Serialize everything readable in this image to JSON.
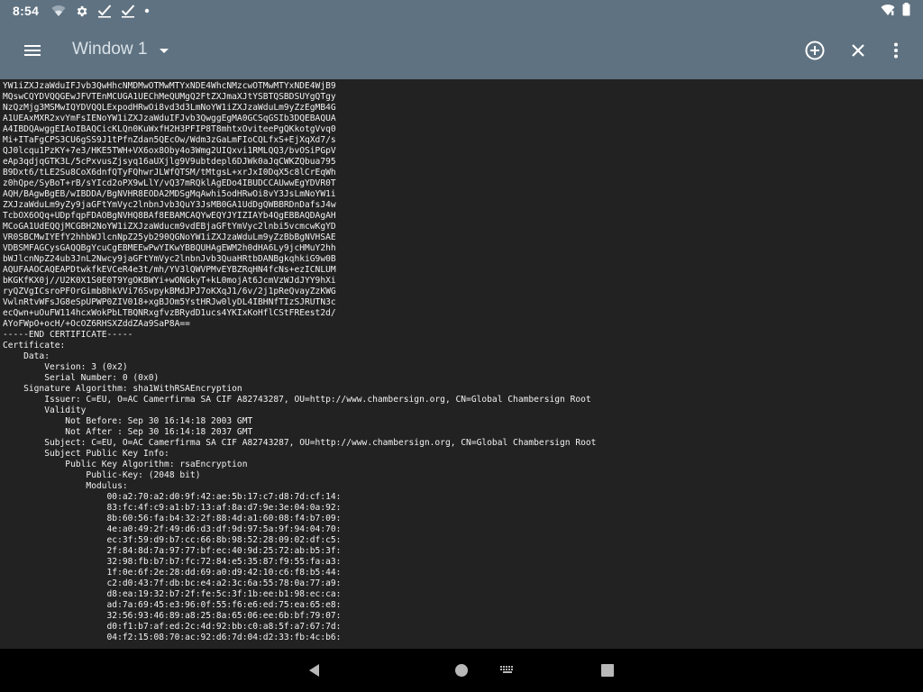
{
  "status_bar": {
    "time": "8:54",
    "icons": [
      "wifi-off-icon",
      "settings-icon",
      "check-icon",
      "check-icon",
      "dot-icon",
      "wifi-icon",
      "battery-icon"
    ]
  },
  "app_bar": {
    "title": "Window 1",
    "icons": [
      "menu-icon",
      "dropdown-icon",
      "add-circle-icon",
      "close-icon",
      "more-vert-icon"
    ]
  },
  "terminal": {
    "lines": [
      "YW1iZXJzaWduIFJvb3QwHhcNMDMwOTMwMTYxNDE4WhcNMzcwOTMwMTYxNDE4WjB9",
      "MQswCQYDVQQGEwJFVTEnMCUGA1UEChMeQUMgQ2FtZXJmaXJtYSBTQSBDSUYgQTgy",
      "NzQzMjg3MSMwIQYDVQQLExpodHRwOi8vd3d3LmNoYW1iZXJzaWduLm9yZzEgMB4G",
      "A1UEAxMXR2xvYmFsIENoYW1iZXJzaWduIFJvb3QwggEgMA0GCSqGSIb3DQEBAQUA",
      "A4IBDQAwggEIAoIBAQCicKLQn0KuWxfH2H3PFIP8T8mhtxOviteePgQKkotgVvq0",
      "Mi+ITaFgCPS3CU6gSS9J1tPfnZdan5QEcOw/Wdm3zGaLmFIoCQLfxS+EjXqXd7/s",
      "QJ0lcqu1PzKY+7e3/HKE5TWH+VX6ox8Oby4o3Wmg2UIQxvi1RMLQQ3/bvOSiPGpV",
      "eAp3qdjqGTK3L/5cPxvusZjsyq16aUXjlg9V9ubtdepl6DJWk0aJqCWKZQbua795",
      "B9Dxt6/tLE2Su8CoX6dnfQTyFQhwrJLWfQTSM/tMtgsL+xrJxI0DqX5c8lCrEqWh",
      "z0hQpe/SyBoT+rB/sYIcd2oPX9wLlY/vQ37mRQklAgEDo4IBUDCCAUwwEgYDVR0T",
      "AQH/BAgwBgEB/wIBDDA/BgNVHR8EODA2MDSgMqAwhi5odHRwOi8vY3JsLmNoYW1i",
      "ZXJzaWduLm9yZy9jaGFtYmVyc2lnbnJvb3QuY3JsMB0GA1UdDgQWBBRDnDafsJ4w",
      "TcbOX6OQq+UDpfqpFDAOBgNVHQ8BAf8EBAMCAQYwEQYJYIZIAYb4QgEBBAQDAgAH",
      "MCoGA1UdEQQjMCGBH2NoYW1iZXJzaWducm9vdEBjaGFtYmVyc2lnbi5vcmcwKgYD",
      "VR0SBCMwIYEfY2hhbWJlcnNpZ25yb290QGNoYW1iZXJzaWduLm9yZzBbBgNVHSAE",
      "VDBSMFAGCysGAQQBgYcuCgEBMEEwPwYIKwYBBQUHAgEWM2h0dHA6Ly9jcHMuY2hh",
      "bWJlcnNpZ24ub3JnL2Nwcy9jaGFtYmVyc2lnbnJvb3QuaHRtbDANBgkqhkiG9w0B",
      "AQUFAAOCAQEAPDtwkfkEVCeR4e3t/mh/YV3lQWVPMvEYBZRqHN4fcNs+ezICNLUM",
      "bKGKfKX0j//U2K0X1S0E0T9YgOKBWYi+wONGkyT+kL0mojAt6JcmVzWJdJYY9hXi",
      "ryQZVgICsroPFOrGimbBhkVVi76SvpykBMdJPJ7oKXqJ1/6v/2j1pReQvayZzKWG",
      "VwlnRtvWFsJG8eSpUPWP0ZIV018+xgBJOm5YstHRJw0lyDL4IBHNfTIzSJRUTN3c",
      "ecQwn+uOuFW114hcxWokPbLTBQNRxgfvzBRydD1ucs4YKIxKoHflCStFREest2d/",
      "AYoFWpO+ocH/+OcOZ6RHSXZddZAa9SaP8A==",
      "-----END CERTIFICATE-----",
      "Certificate:",
      "    Data:",
      "        Version: 3 (0x2)",
      "        Serial Number: 0 (0x0)",
      "    Signature Algorithm: sha1WithRSAEncryption",
      "        Issuer: C=EU, O=AC Camerfirma SA CIF A82743287, OU=http://www.chambersign.org, CN=Global Chambersign Root",
      "        Validity",
      "            Not Before: Sep 30 16:14:18 2003 GMT",
      "            Not After : Sep 30 16:14:18 2037 GMT",
      "        Subject: C=EU, O=AC Camerfirma SA CIF A82743287, OU=http://www.chambersign.org, CN=Global Chambersign Root",
      "        Subject Public Key Info:",
      "            Public Key Algorithm: rsaEncryption",
      "                Public-Key: (2048 bit)",
      "                Modulus:",
      "                    00:a2:70:a2:d0:9f:42:ae:5b:17:c7:d8:7d:cf:14:",
      "                    83:fc:4f:c9:a1:b7:13:af:8a:d7:9e:3e:04:0a:92:",
      "                    8b:60:56:fa:b4:32:2f:88:4d:a1:60:08:f4:b7:09:",
      "                    4e:a0:49:2f:49:d6:d3:df:9d:97:5a:9f:94:04:70:",
      "                    ec:3f:59:d9:b7:cc:66:8b:98:52:28:09:02:df:c5:",
      "                    2f:84:8d:7a:97:77:bf:ec:40:9d:25:72:ab:b5:3f:",
      "                    32:98:fb:b7:b7:fc:72:84:e5:35:87:f9:55:fa:a3:",
      "                    1f:0e:6f:2e:28:dd:69:a0:d9:42:10:c6:f8:b5:44:",
      "                    c2:d0:43:7f:db:bc:e4:a2:3c:6a:55:78:0a:77:a9:",
      "                    d8:ea:19:32:b7:2f:fe:5c:3f:1b:ee:b1:98:ec:ca:",
      "                    ad:7a:69:45:e3:96:0f:55:f6:e6:ed:75:ea:65:e8:",
      "                    32:56:93:46:89:a8:25:8a:65:06:ee:6b:bf:79:07:",
      "                    d0:f1:b7:af:ed:2c:4d:92:bb:c0:a8:5f:a7:67:7d:",
      "                    04:f2:15:08:70:ac:92:d6:7d:04:d2:33:fb:4c:b6:"
    ]
  },
  "nav_bar": {
    "icons": [
      "back-icon",
      "home-icon",
      "keyboard-icon",
      "recents-icon"
    ]
  },
  "colors": {
    "app_bar": "#5f7281",
    "terminal_bg": "#222222",
    "terminal_fg": "#f2f2f2"
  }
}
